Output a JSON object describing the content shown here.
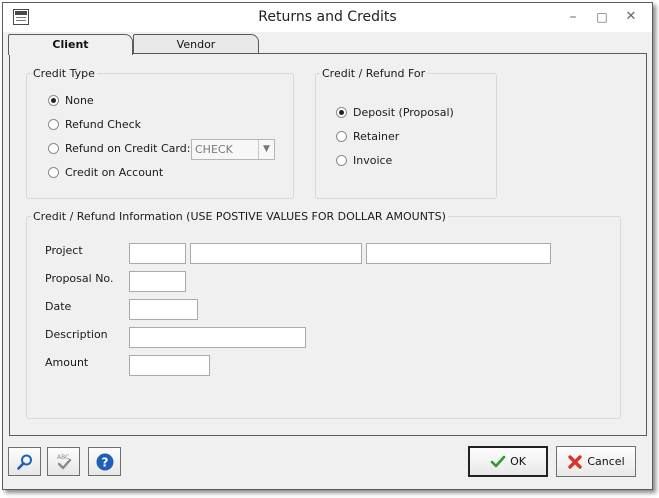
{
  "window": {
    "title": "Returns and Credits",
    "controls": {
      "minimize": "–",
      "maximize": "□",
      "close": "✕"
    }
  },
  "tabs": [
    {
      "label": "Client",
      "active": true
    },
    {
      "label": "Vendor",
      "active": false
    }
  ],
  "credit_type": {
    "legend": "Credit Type",
    "options": [
      {
        "label": "None",
        "checked": true
      },
      {
        "label": "Refund Check",
        "checked": false
      },
      {
        "label": "Refund on Credit Card:",
        "checked": false
      },
      {
        "label": "Credit on Account",
        "checked": false
      }
    ],
    "card_type_value": "CHECK"
  },
  "credit_for": {
    "legend": "Credit / Refund For",
    "options": [
      {
        "label": "Deposit (Proposal)",
        "checked": true
      },
      {
        "label": "Retainer",
        "checked": false
      },
      {
        "label": "Invoice",
        "checked": false
      }
    ]
  },
  "info": {
    "legend": "Credit / Refund Information (USE POSTIVE VALUES FOR DOLLAR AMOUNTS)",
    "project_label": "Project",
    "proposal_label": "Proposal No.",
    "date_label": "Date",
    "description_label": "Description",
    "amount_label": "Amount",
    "project_code": "",
    "project_name": "",
    "project_extra": "",
    "proposal_no": "",
    "date": "",
    "description": "",
    "amount": ""
  },
  "footer": {
    "search_icon": "magnifier-icon",
    "spell_icon": "spellcheck-icon",
    "help_icon": "help-icon",
    "ok_label": "OK",
    "cancel_label": "Cancel"
  },
  "colors": {
    "help_blue": "#1f5fb8",
    "ok_green": "#2a9d2a",
    "cancel_red": "#d9342b"
  }
}
